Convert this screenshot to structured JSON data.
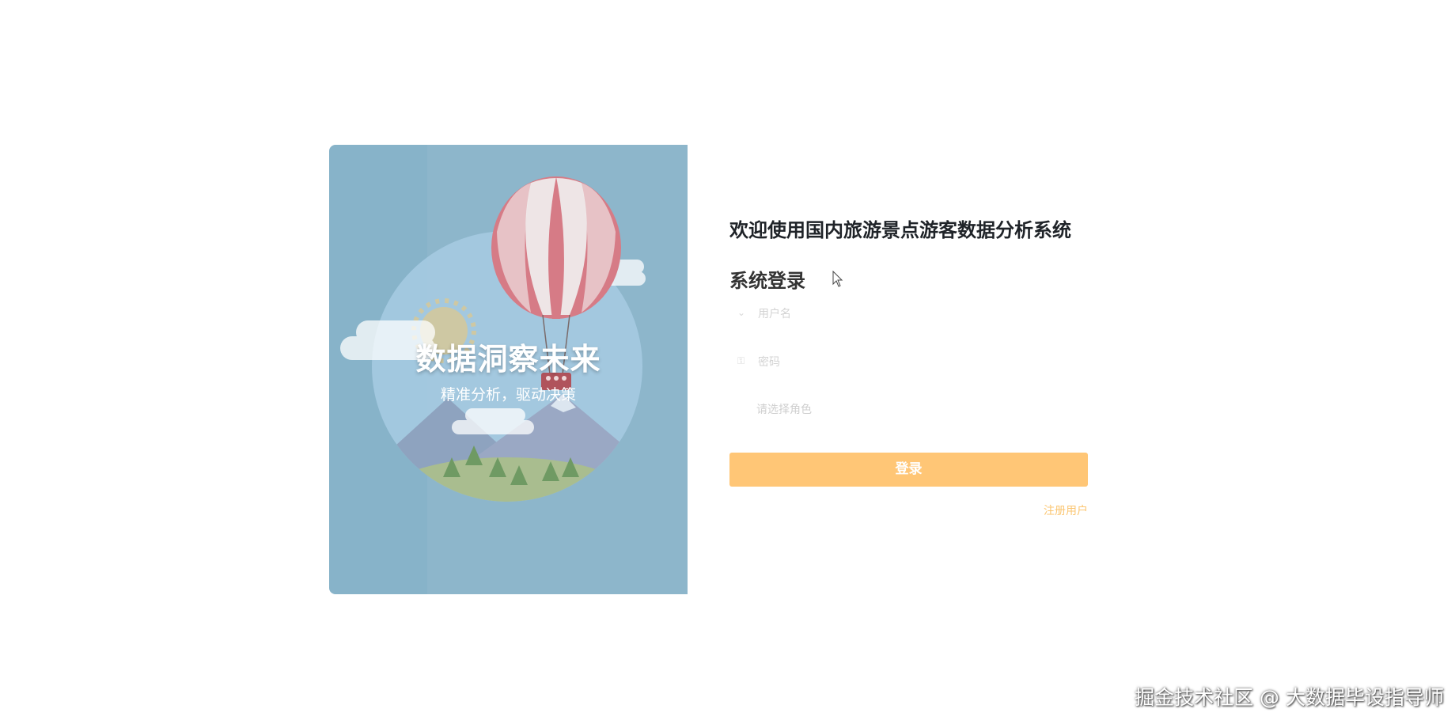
{
  "hero": {
    "title": "数据洞察未来",
    "subtitle": "精准分析，驱动决策"
  },
  "login": {
    "welcome": "欢迎使用国内旅游景点游客数据分析系统",
    "heading": "系统登录",
    "username_placeholder": "用户名",
    "password_placeholder": "密码",
    "role_placeholder": "请选择角色",
    "login_button": "登录",
    "register_link": "注册用户"
  },
  "watermark": "掘金技术社区 @ 大数据毕设指导师",
  "colors": {
    "panel_bg": "#87b3c9",
    "button": "#ffc676",
    "link": "#fbc672"
  },
  "icons": [
    "user-icon",
    "lock-icon",
    "cursor-icon"
  ]
}
